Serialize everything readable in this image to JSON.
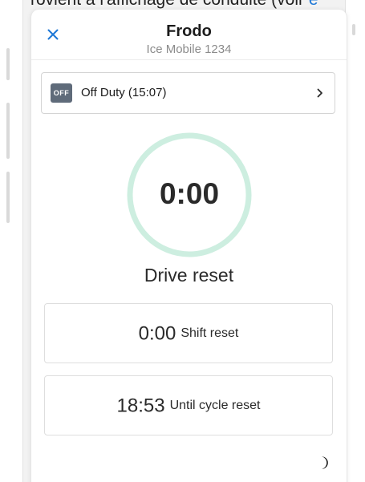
{
  "background": {
    "text_fragment": "rovient à l'affichage de conduite (voir ",
    "link_fragment": "e"
  },
  "header": {
    "title": "Frodo",
    "subtitle": "Ice Mobile 1234",
    "close_icon": "close-icon"
  },
  "status": {
    "badge": "OFF",
    "label": "Off Duty (15:07)",
    "chevron_icon": "chevron-right-icon"
  },
  "drive": {
    "value": "0:00",
    "label": "Drive reset",
    "ring_fraction": 0
  },
  "shift": {
    "value": "0:00",
    "label": "Shift reset"
  },
  "cycle": {
    "value": "18:53",
    "label": "Until cycle reset"
  },
  "footer": {
    "theme_icon": "moon-icon"
  },
  "colors": {
    "accent": "#1e78d7",
    "ring": "#cdeee0",
    "badge": "#5f6b7a"
  }
}
